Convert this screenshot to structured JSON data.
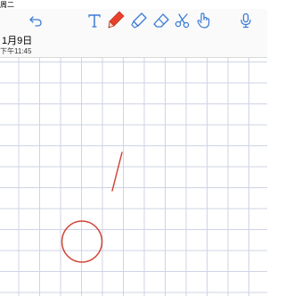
{
  "status_bar": {
    "text": "周二"
  },
  "toolbar": {
    "tools": [
      {
        "name": "undo",
        "icon": "undo-icon"
      },
      {
        "name": "text",
        "icon": "text-tool-icon"
      },
      {
        "name": "pen",
        "icon": "pen-icon",
        "selected": true,
        "color": "#e8402a"
      },
      {
        "name": "highlighter",
        "icon": "highlighter-icon"
      },
      {
        "name": "eraser",
        "icon": "eraser-icon"
      },
      {
        "name": "lasso",
        "icon": "scissors-icon"
      },
      {
        "name": "hand",
        "icon": "hand-pointer-icon"
      },
      {
        "name": "microphone",
        "icon": "microphone-icon"
      }
    ],
    "accent_color": "#3a7bd5"
  },
  "note": {
    "date": "1月9日",
    "time": "下午11:45"
  },
  "canvas": {
    "background": "grid-paper",
    "grid_color": "#cfd3e6",
    "strokes": [
      {
        "type": "line",
        "color": "#d0483a"
      },
      {
        "type": "circle",
        "color": "#d0483a"
      }
    ]
  }
}
